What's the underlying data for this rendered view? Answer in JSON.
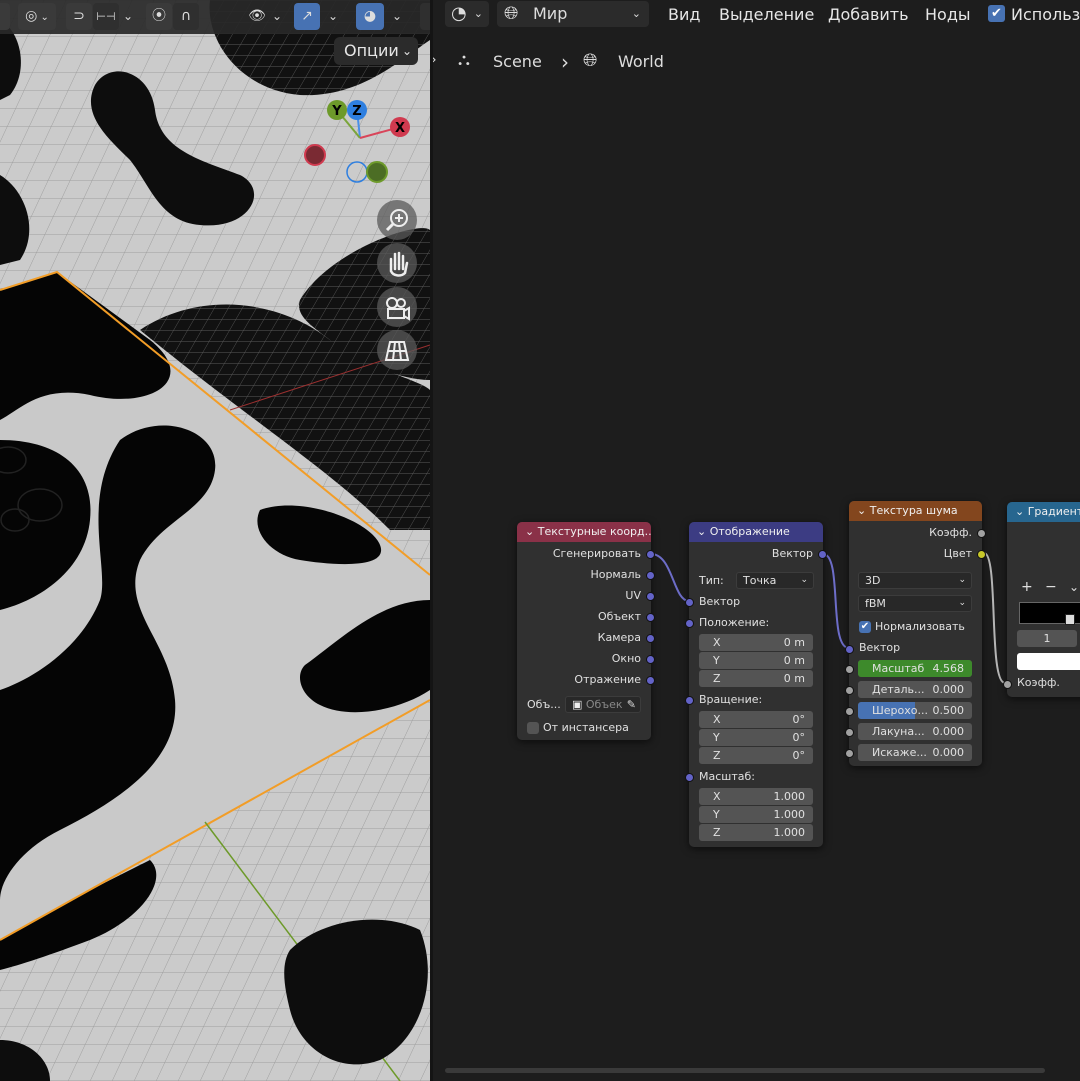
{
  "viewport": {
    "options_label": "Опции",
    "gizmo": {
      "y": "Y",
      "z": "Z",
      "x": "X"
    },
    "icons": [
      "editor-type-icon",
      "snap-icon",
      "proportional-icon",
      "visibility-icon",
      "gizmo-icon",
      "overlay-icon",
      "zoom-icon",
      "hand-pan-icon",
      "camera-icon",
      "grid-perspective-icon"
    ]
  },
  "node_editor": {
    "header": {
      "world_label": "Мир",
      "menu": [
        "Вид",
        "Выделение",
        "Добавить",
        "Ноды"
      ],
      "use_nodes_label": "Использо"
    },
    "breadcrumb": {
      "scene": "Scene",
      "world": "World"
    },
    "nodes": {
      "texcoord": {
        "title": "Текстурные коорд...",
        "color": "#8a3148",
        "outputs": [
          "Сгенерировать",
          "Нормаль",
          "UV",
          "Объект",
          "Камера",
          "Окно",
          "Отражение"
        ],
        "object_label": "Объ...",
        "object_placeholder": "Объек",
        "from_instancer": "От инстансера"
      },
      "mapping": {
        "title": "Отображение",
        "color": "#3c3c83",
        "output": "Вектор",
        "type_label": "Тип:",
        "type_value": "Точка",
        "vector_in": "Вектор",
        "location_label": "Положение:",
        "location": [
          {
            "axis": "X",
            "value": "0 m"
          },
          {
            "axis": "Y",
            "value": "0 m"
          },
          {
            "axis": "Z",
            "value": "0 m"
          }
        ],
        "rotation_label": "Вращение:",
        "rotation": [
          {
            "axis": "X",
            "value": "0°"
          },
          {
            "axis": "Y",
            "value": "0°"
          },
          {
            "axis": "Z",
            "value": "0°"
          }
        ],
        "scale_label": "Масштаб:",
        "scale": [
          {
            "axis": "X",
            "value": "1.000"
          },
          {
            "axis": "Y",
            "value": "1.000"
          },
          {
            "axis": "Z",
            "value": "1.000"
          }
        ]
      },
      "noise": {
        "title": "Текстура шума",
        "color": "#83461e",
        "out_fac": "Коэфф.",
        "out_color": "Цвет",
        "dim_value": "3D",
        "type_value": "fBM",
        "normalize_label": "Нормализовать",
        "vector_in": "Вектор",
        "inputs": [
          {
            "label": "Масштаб",
            "value": "4.568",
            "fill": 1.0,
            "color": "#3d8a2b"
          },
          {
            "label": "Деталь...",
            "value": "0.000",
            "fill": 0,
            "color": "#545454"
          },
          {
            "label": "Шерохо...",
            "value": "0.500",
            "fill": 0.5,
            "color": "#4772b3"
          },
          {
            "label": "Лакуна...",
            "value": "0.000",
            "fill": 0,
            "color": "#545454"
          },
          {
            "label": "Искаже...",
            "value": "0.000",
            "fill": 0,
            "color": "#545454"
          }
        ]
      },
      "ramp": {
        "title": "Градиент",
        "color": "#27668f",
        "add": "+",
        "remove": "−",
        "index": "1",
        "fac_in": "Коэфф."
      }
    }
  }
}
